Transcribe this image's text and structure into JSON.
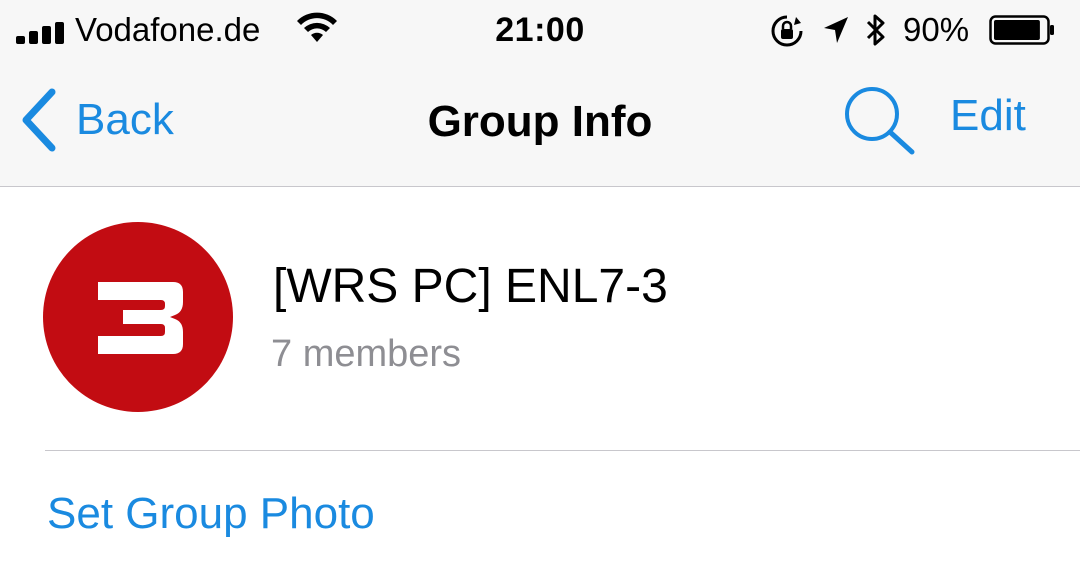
{
  "status_bar": {
    "carrier": "Vodafone.de",
    "time": "21:00",
    "battery_percent": "90%",
    "battery_level": 0.9,
    "icons": [
      "signal-icon",
      "wifi-icon",
      "rotation-lock-icon",
      "location-icon",
      "bluetooth-icon",
      "battery-icon"
    ]
  },
  "nav": {
    "back_label": "Back",
    "title": "Group Info",
    "edit_label": "Edit",
    "search_icon": "search-icon"
  },
  "group": {
    "name": "[WRS PC] ENL7-3",
    "members": "7 members",
    "avatar_color": "#c20c12"
  },
  "actions": {
    "set_group_photo": "Set Group Photo"
  },
  "colors": {
    "accent": "#1a8ae0",
    "secondary_text": "#8e8e93"
  }
}
